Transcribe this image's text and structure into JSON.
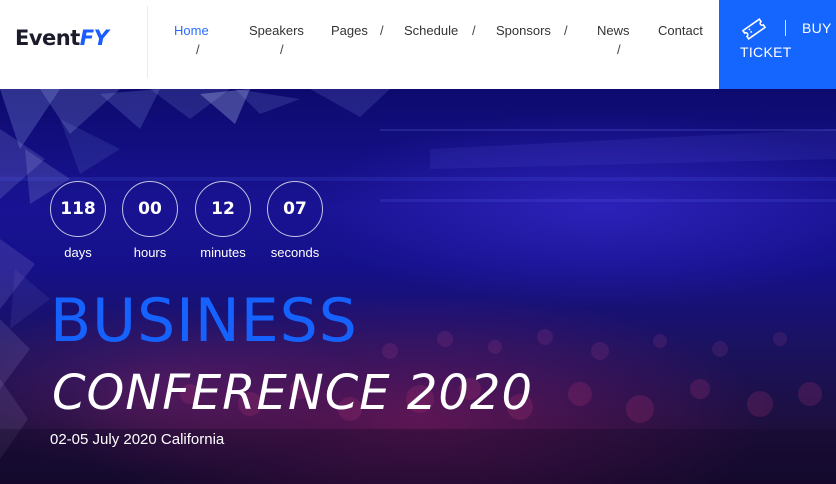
{
  "header": {
    "logo": {
      "part1": "Event",
      "part2": "FY"
    },
    "nav": [
      {
        "label": "Home",
        "active": true
      },
      {
        "label": "Speakers",
        "active": false
      },
      {
        "label": "Pages",
        "active": false
      },
      {
        "label": "Schedule",
        "active": false
      },
      {
        "label": "Sponsors",
        "active": false
      },
      {
        "label": "News",
        "active": false
      },
      {
        "label": "Contact",
        "active": false
      }
    ],
    "separator": "/",
    "buy": {
      "top": "BUY",
      "bottom": "TICKET",
      "icon": "ticket-icon"
    }
  },
  "hero": {
    "countdown": [
      {
        "value": "118",
        "label": "days"
      },
      {
        "value": "00",
        "label": "hours"
      },
      {
        "value": "12",
        "label": "minutes"
      },
      {
        "value": "07",
        "label": "seconds"
      }
    ],
    "title_line1": "BUSINESS",
    "title_line2": "CONFERENCE 2020",
    "subtitle": "02-05 July 2020 California"
  },
  "colors": {
    "accent": "#1565ff",
    "title_blue": "#1662ff",
    "active_nav": "#2a6cff",
    "text_dark": "#333333"
  }
}
